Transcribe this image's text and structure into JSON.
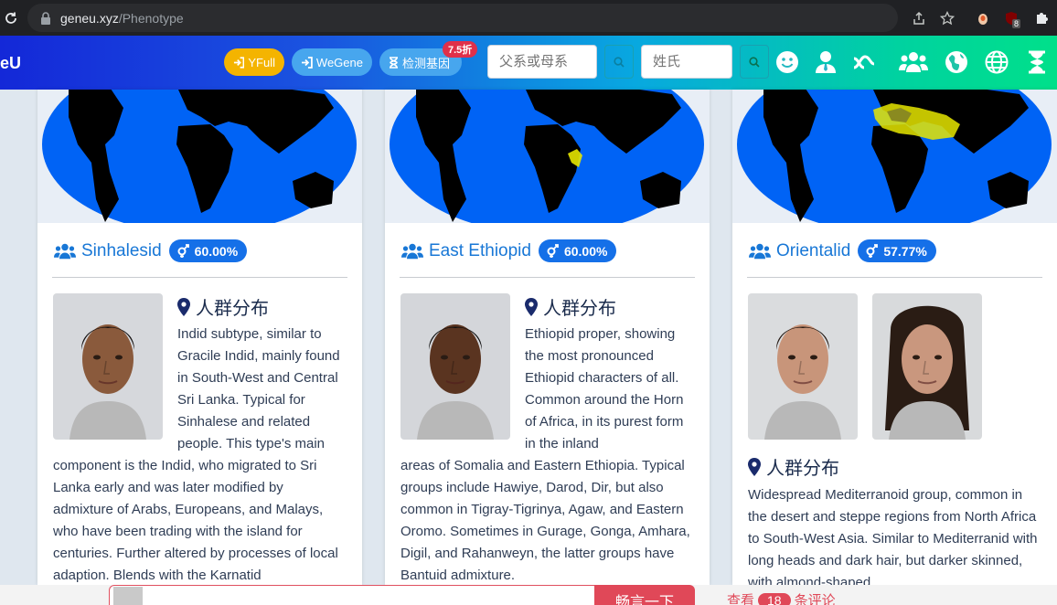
{
  "browser": {
    "url_host": "geneu.xyz",
    "url_path": "/Phenotype",
    "ublock_count": "8"
  },
  "navbar": {
    "brand": "eU",
    "yfull_label": "YFull",
    "wegene_label": "WeGene",
    "test_label": "检测基因",
    "discount_badge": "7.5折",
    "lineage_placeholder": "父系或母系",
    "surname_placeholder": "姓氏",
    "icons": [
      "smile-icon",
      "user-tie-icon",
      "dna-icon",
      "users-icon",
      "globe-africa-icon",
      "globe-icon",
      "hourglass-icon"
    ]
  },
  "cards": [
    {
      "name": "Sinhalesid",
      "percent": "60.00%",
      "distribution_title": "人群分布",
      "desc_float": "Indid subtype, similar to Gracile Indid, mainly found in South-West and Central Sri Lanka. Typical for Sinhalese and related people. This type's main",
      "desc_rest": "component is the Indid, who migrated to Sri Lanka early and was later modified by admixture of Arabs, Europeans, and Malays, who have been trading with the island for centuries. Further altered by processes of local adaption. Blends with the Karnatid"
    },
    {
      "name": "East Ethiopid",
      "percent": "60.00%",
      "distribution_title": "人群分布",
      "desc_float": "Ethiopid proper, showing the most pronounced Ethiopid characters of all. Common around the Horn of Africa, in its purest form in the inland",
      "desc_rest": "areas of Somalia and Eastern Ethiopia. Typical groups include Hawiye, Darod, Dir, but also common in Tigray-Tigrinya, Agaw, and Eastern Oromo. Sometimes in Gurage, Gonga, Amhara, Digil, and Rahanweyn, the latter groups have Bantuid admixture."
    },
    {
      "name": "Orientalid",
      "percent": "57.77%",
      "distribution_title": "人群分布",
      "desc_rest": "Widespread Mediterranoid group, common in the desert and steppe regions from North Africa to South-West Asia. Similar to Mediterranid with long heads and dark hair, but darker skinned, with almond-shaped"
    }
  ],
  "comment_bar": {
    "send_label": "畅言一下",
    "view_prefix": "查看",
    "comment_count": "18",
    "view_suffix": "条评论"
  },
  "colors": {
    "map_ocean": "#0063f5",
    "map_land": "#000000",
    "map_highlight": "#e6e600",
    "accent_blue": "#1570e8"
  }
}
